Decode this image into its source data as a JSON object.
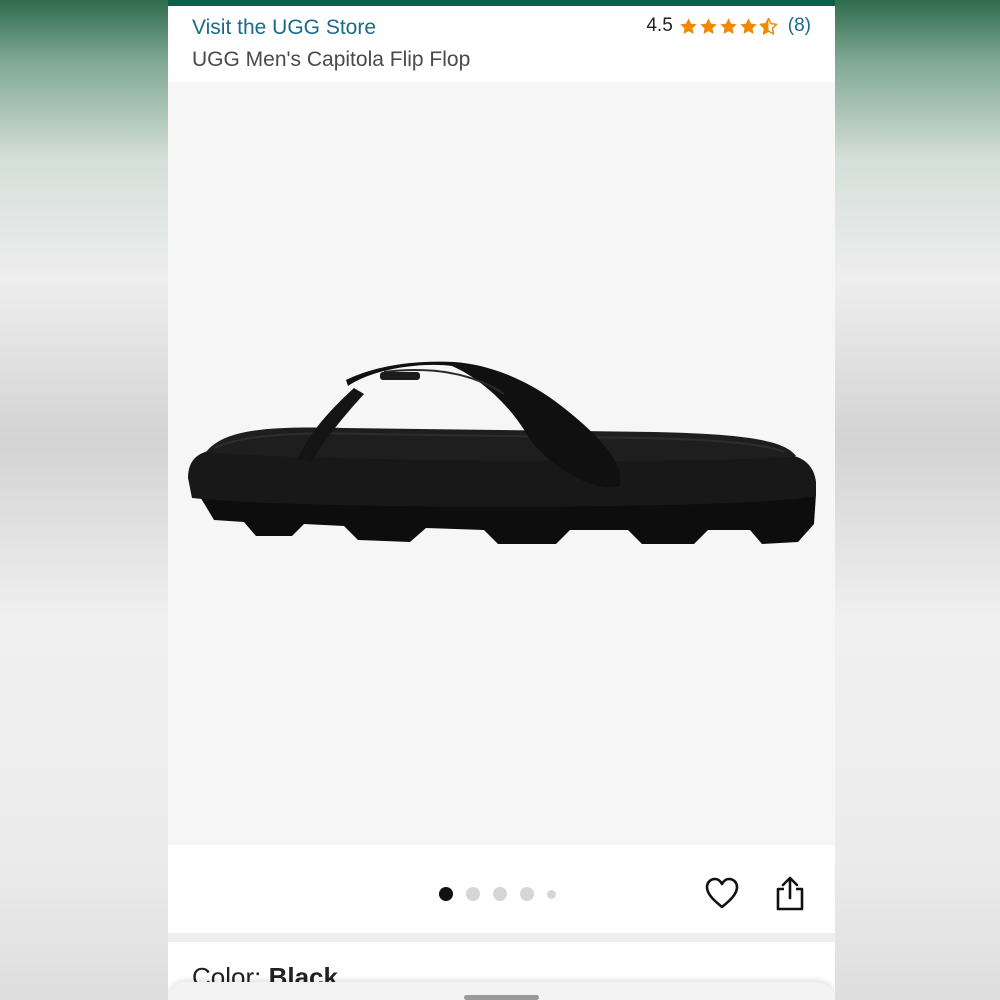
{
  "header": {
    "store_link": "Visit the UGG Store",
    "rating_value": "4.5",
    "review_count": "(8)",
    "product_title": "UGG Men's Capitola Flip Flop"
  },
  "rating": {
    "stars": 4.5,
    "max": 5
  },
  "gallery": {
    "image_count": 5,
    "active_index": 0
  },
  "actions": {
    "favorite_icon": "heart-icon",
    "share_icon": "share-icon"
  },
  "variation": {
    "color_label": "Color:",
    "color_value": "Black"
  },
  "colors": {
    "accent_bar": "#0f5f48",
    "link": "#1a6a8a",
    "star": "#f08804"
  }
}
